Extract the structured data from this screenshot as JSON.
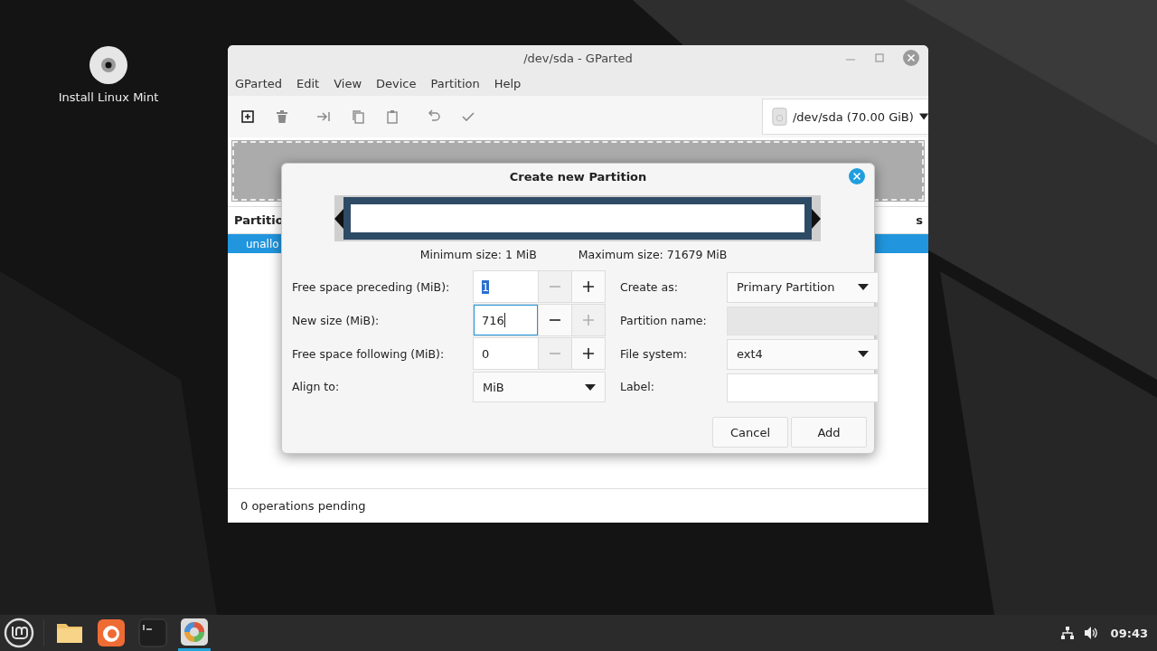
{
  "desktop": {
    "icons": [
      {
        "label": "Install Linux Mint"
      }
    ]
  },
  "window": {
    "title": "/dev/sda - GParted",
    "menu": [
      "GParted",
      "Edit",
      "View",
      "Device",
      "Partition",
      "Help"
    ],
    "toolbar": [
      {
        "kind": "new",
        "disabled": false
      },
      {
        "kind": "delete",
        "disabled": true
      },
      {
        "kind": "resize",
        "disabled": true
      },
      {
        "kind": "copy",
        "disabled": true
      },
      {
        "kind": "paste",
        "disabled": true
      },
      {
        "kind": "undo",
        "disabled": true
      },
      {
        "kind": "apply",
        "disabled": true
      }
    ],
    "device": "/dev/sda (70.00 GiB)",
    "table": {
      "columns": [
        "Partitio",
        "s"
      ],
      "rows": [
        {
          "cells": [
            "unallo"
          ],
          "selected": true
        }
      ]
    },
    "status_bar": "0 operations pending"
  },
  "dialog": {
    "title": "Create new Partition",
    "min_size": "Minimum size: 1 MiB",
    "max_size": "Maximum size: 71679 MiB",
    "left_fields": [
      {
        "kind": "spin",
        "label": "Free space preceding (MiB):",
        "value": "1",
        "text_selected": true,
        "focused": false,
        "decrement_disabled": true,
        "increment_disabled": false
      },
      {
        "kind": "spin",
        "label": "New size (MiB):",
        "value": "716",
        "text_selected": false,
        "focused": true,
        "decrement_disabled": false,
        "increment_disabled": true
      },
      {
        "kind": "spin",
        "label": "Free space following (MiB):",
        "value": "0",
        "text_selected": false,
        "focused": false,
        "decrement_disabled": true,
        "increment_disabled": false
      },
      {
        "kind": "combo",
        "label": "Align to:",
        "value": "MiB"
      }
    ],
    "right_fields": [
      {
        "kind": "combo",
        "label": "Create as:",
        "value": "Primary Partition"
      },
      {
        "kind": "entry",
        "label": "Partition name:",
        "disabled": true
      },
      {
        "kind": "combo",
        "label": "File system:",
        "value": "ext4"
      },
      {
        "kind": "entry",
        "label": "Label:",
        "disabled": false
      }
    ],
    "buttons": [
      "Cancel",
      "Add"
    ]
  },
  "taskbar": {
    "launchers": [
      {
        "kind": "files",
        "active": false
      },
      {
        "kind": "browser",
        "active": false
      },
      {
        "kind": "terminal",
        "active": false
      },
      {
        "kind": "gparted",
        "active": true
      }
    ],
    "clock": "09:43"
  }
}
